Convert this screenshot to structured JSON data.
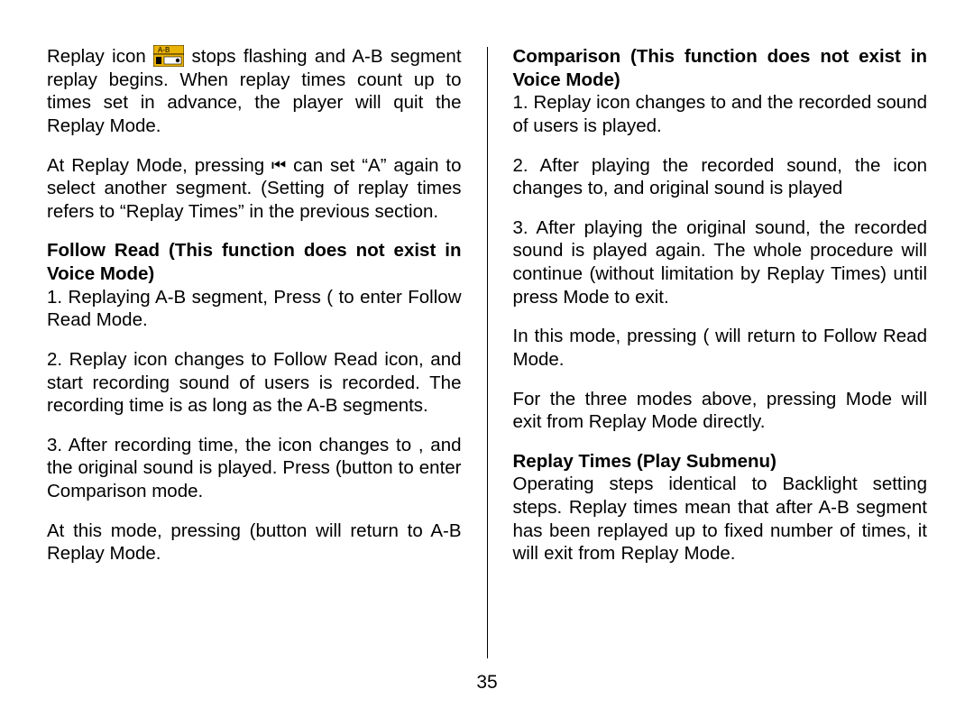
{
  "page_number": "35",
  "icons": {
    "replay": "replay-ab-icon",
    "prev": "⏮"
  },
  "left": {
    "p1a": "Replay icon ",
    "p1b": " stops flashing and A-B segment replay begins. When replay times count up to times set in advance, the player will quit the Replay Mode.",
    "p2a": "At Replay Mode, pressing ",
    "p2b": " can set “A” again to select another segment. (Setting of replay times refers to “Replay Times”  in the previous section.",
    "h1": "Follow Read (This function does not exist in Voice Mode)",
    "p3": "1. Replaying A-B segment, Press ( to enter Follow Read Mode.",
    "p4": "2. Replay icon  changes to Follow Read icon, and start recording sound of users is recorded. The recording time is as long as the A-B segments.",
    "p5": "3. After recording time, the icon changes to , and the original sound is played. Press (button to enter Comparison mode.",
    "p6": "At this mode, pressing (button will return to A-B Replay Mode."
  },
  "right": {
    "h1": "Comparison (This function does not exist in Voice Mode)",
    "p1": "1. Replay icon changes to  and the recorded sound of users is played.",
    "p2": "2. After playing the recorded sound, the icon changes to, and original sound is played",
    "p3": "3. After playing the original sound, the recorded sound is played again. The whole procedure will continue (without limitation by Replay Times) until press Mode to exit.",
    "p4": "In this mode, pressing ( will return to Follow Read Mode.",
    "p5": "For the three modes above, pressing Mode will exit from Replay Mode directly.",
    "h2": "Replay Times (Play Submenu)",
    "p6": "Operating steps identical to Backlight setting steps.   Replay times mean that after A-B segment has been replayed up to fixed number of times, it will exit from Replay Mode."
  }
}
